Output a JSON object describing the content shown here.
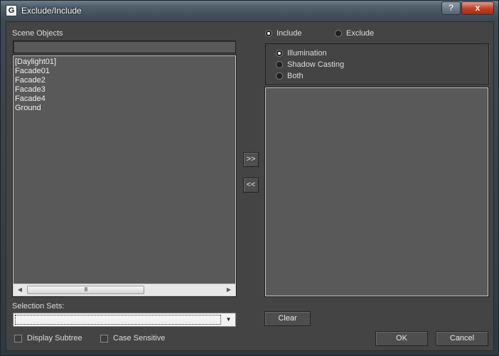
{
  "window": {
    "title": "Exclude/Include",
    "app_icon": "3ds-max-logo-icon",
    "help_label": "?",
    "close_label": "x"
  },
  "scene_objects": {
    "label": "Scene Objects",
    "filter_value": "",
    "items": [
      "[Daylight01]",
      "Facade01",
      "Facade2",
      "Facade3",
      "Facade4",
      "Ground"
    ],
    "scroll_thumb_label": "III",
    "scroll_left": "◀",
    "scroll_right": "▶"
  },
  "transfer": {
    "add_label": ">>",
    "remove_label": "<<"
  },
  "mode": {
    "include_label": "Include",
    "exclude_label": "Exclude",
    "selected": "Include"
  },
  "affect": {
    "illumination_label": "Illumination",
    "shadow_label": "Shadow Casting",
    "both_label": "Both",
    "selected": "Illumination"
  },
  "selection_sets": {
    "label": "Selection Sets:",
    "value": "",
    "drop_arrow": "▼"
  },
  "options": {
    "display_subtree_label": "Display Subtree",
    "display_subtree_checked": false,
    "case_sensitive_label": "Case Sensitive",
    "case_sensitive_checked": false
  },
  "buttons": {
    "clear_label": "Clear",
    "ok_label": "OK",
    "cancel_label": "Cancel"
  }
}
